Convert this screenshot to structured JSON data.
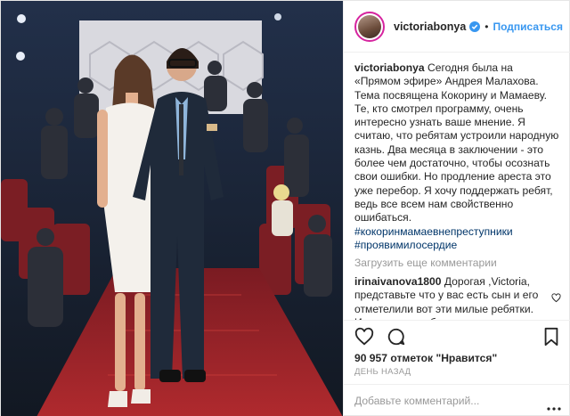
{
  "header": {
    "username": "victoriabonya",
    "separator": "•",
    "follow_label": "Подписаться"
  },
  "caption": {
    "username": "victoriabonya",
    "text": "Сегодня была на «Прямом эфире» Андрея Малахова. Тема посвящена Кокорину и Мамаеву. Те, кто смотрел программу, очень интересно узнать ваше мнение. Я считаю, что ребятам устроили народную казнь. Два месяца в заключении - это более чем достаточно, чтобы осознать свои ошибки. Но продление ареста это уже перебор. Я хочу поддержать ребят, ведь все всем нам свойственно ошибаться.",
    "hashtags": [
      "#кокоринмамаевнепреступники",
      "#проявимилосердие"
    ]
  },
  "load_more_label": "Загрузить еще комментарии",
  "comment": {
    "username": "irinaivanova1800",
    "text": "Дорогая ,Victoria, представьте что у вас есть сын и его отметелили вот эти милые ребятки. Интересно как бы вы"
  },
  "likes": {
    "count": "90 957",
    "label": "отметок \"Нравится\""
  },
  "time_label": "ДЕНЬ НАЗАД",
  "add_comment": {
    "placeholder": "Добавьте комментарий..."
  },
  "colors": {
    "accent": "#3897f0",
    "verified": "#3897f0",
    "hashtag": "#003569",
    "muted": "#999999"
  }
}
